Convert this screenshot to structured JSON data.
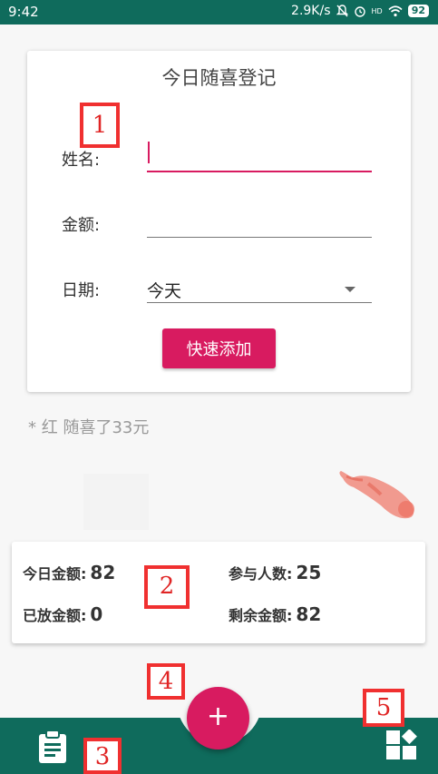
{
  "status_bar": {
    "time": "9:42",
    "network_speed": "2.9K/s",
    "network_type": "HD",
    "battery": "92"
  },
  "form": {
    "title": "今日随喜登记",
    "name_label": "姓名:",
    "name_value": "",
    "amount_label": "金额:",
    "amount_value": "",
    "date_label": "日期:",
    "date_value": "今天",
    "quick_add_label": "快速添加"
  },
  "recent_entry": "* 红 随喜了33元",
  "stats": {
    "today_amount_label": "今日金额:",
    "today_amount_value": "82",
    "participants_label": "参与人数:",
    "participants_value": "25",
    "released_amount_label": "已放金额:",
    "released_amount_value": "0",
    "remaining_amount_label": "剩余金额:",
    "remaining_amount_value": "82"
  },
  "fab_label": "+",
  "annotations": [
    "1",
    "2",
    "3",
    "4",
    "5"
  ],
  "colors": {
    "primary": "#0f6b5c",
    "accent": "#d81b60",
    "annotation": "#f03030"
  },
  "icons": {
    "left_nav": "clipboard-icon",
    "right_nav": "dashboard-icon",
    "decoration": "koi-fish"
  }
}
